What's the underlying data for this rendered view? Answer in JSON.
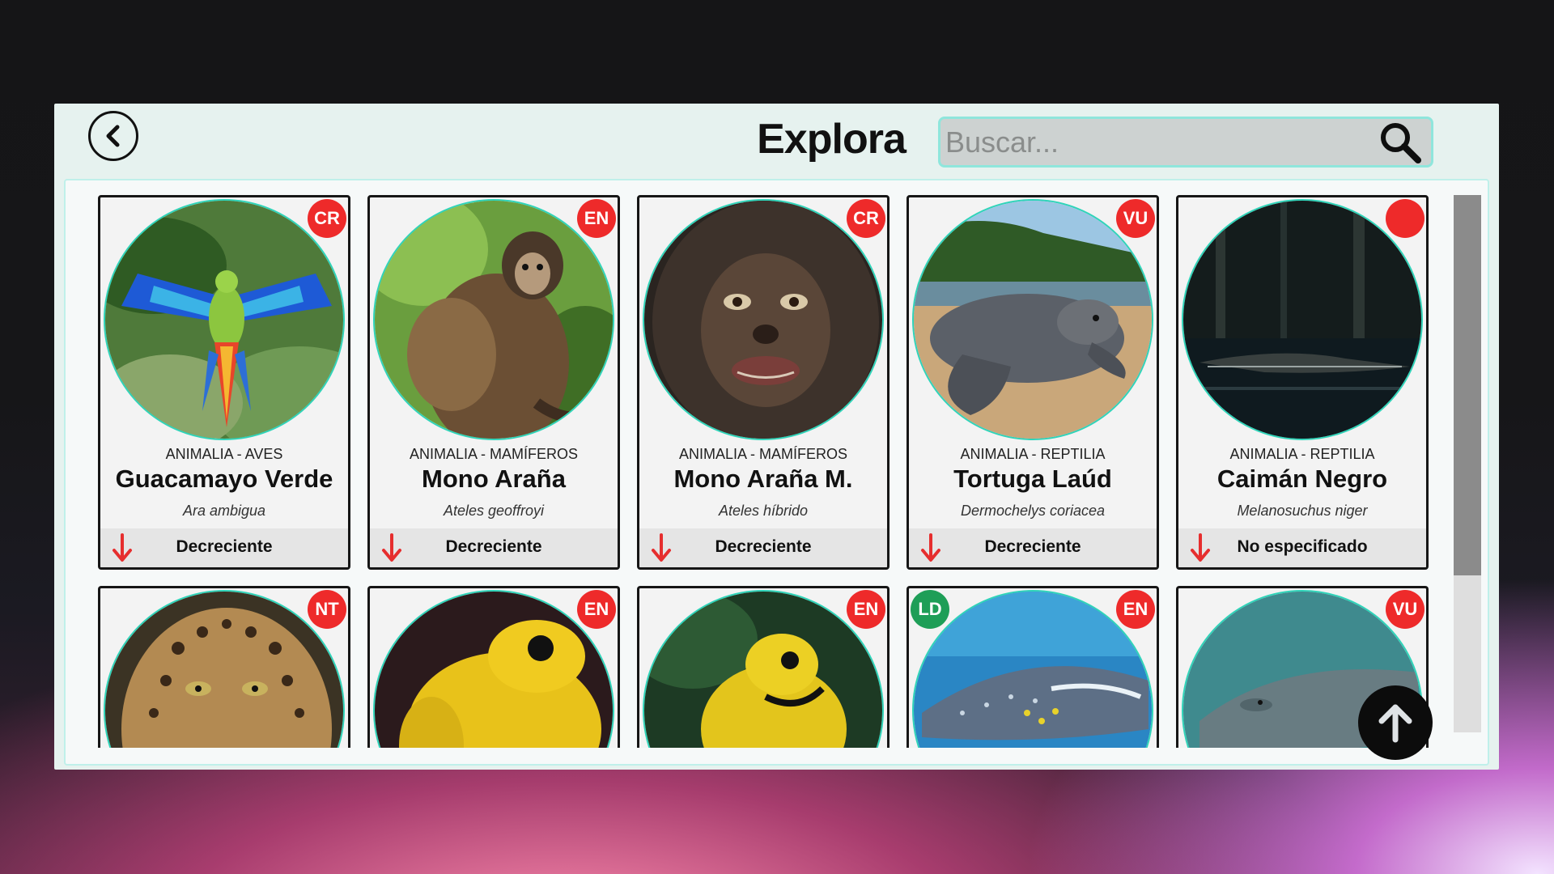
{
  "header": {
    "title": "Explora",
    "search_placeholder": "Buscar..."
  },
  "colors": {
    "accent": "#2fd4b9",
    "badge_red": "#ee2a2a",
    "badge_green": "#1e9e57",
    "trend_down": "#e62e2e"
  },
  "cards": [
    {
      "taxon": "ANIMALIA - AVES",
      "name": "Guacamayo Verde",
      "scientific": "Ara ambigua",
      "status": "CR",
      "trend": "Decreciente",
      "trend_icon": "arrow-down-icon",
      "image": "macaw-photo"
    },
    {
      "taxon": "ANIMALIA - MAMÍFEROS",
      "name": "Mono Araña",
      "scientific": "Ateles geoffroyi",
      "status": "EN",
      "trend": "Decreciente",
      "trend_icon": "arrow-down-icon",
      "image": "spider-monkey-photo"
    },
    {
      "taxon": "ANIMALIA - MAMÍFEROS",
      "name": "Mono Araña M.",
      "scientific": "Ateles híbrido",
      "status": "CR",
      "trend": "Decreciente",
      "trend_icon": "arrow-down-icon",
      "image": "dark-monkey-photo"
    },
    {
      "taxon": "ANIMALIA - REPTILIA",
      "name": "Tortuga Laúd",
      "scientific": "Dermochelys coriacea",
      "status": "VU",
      "trend": "Decreciente",
      "trend_icon": "arrow-down-icon",
      "image": "leatherback-turtle-photo"
    },
    {
      "taxon": "ANIMALIA - REPTILIA",
      "name": "Caimán Negro",
      "scientific": "Melanosuchus niger",
      "status": "",
      "trend": "No especificado",
      "trend_icon": "arrow-down-icon",
      "image": "black-caiman-photo"
    }
  ],
  "row2": [
    {
      "status": "NT",
      "image": "jaguar-photo"
    },
    {
      "status": "EN",
      "image": "yellow-frog-photo"
    },
    {
      "status": "EN",
      "image": "yellow-black-frog-photo"
    },
    {
      "status": "EN",
      "status_left": "LD",
      "image": "whale-shark-photo"
    },
    {
      "status": "VU",
      "image": "manatee-photo"
    }
  ]
}
